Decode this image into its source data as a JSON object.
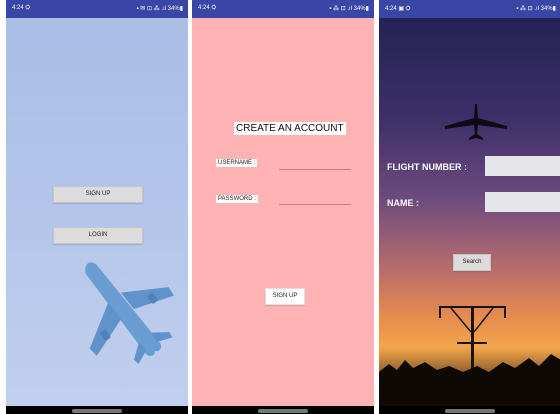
{
  "colors": {
    "statusbar": "#3a46a6",
    "login_bg": "#b3c5ea",
    "signup_bg": "#ffb3b5",
    "button_gray": "#dcdcdc"
  },
  "screens": [
    {
      "status": {
        "time": "4:24 ⛭",
        "icons": "▪ ✉ ⊡ ⁂ .ıl 34%▮"
      },
      "buttons": {
        "signup": "SIGN UP",
        "login": "LOGIN"
      },
      "illustration": "airplane-icon"
    },
    {
      "status": {
        "time": "4:24 ⛭",
        "icons": "▪ ⁂ ⊡ .ıl 34%▮"
      },
      "title": "CREATE AN ACCOUNT",
      "fields": {
        "username_label": "USERNAME :",
        "password_label": "PASSWORD :"
      },
      "button": "SIGN UP"
    },
    {
      "status": {
        "time": "4:24 ▣ ⛭",
        "icons": "▪ ⁂ ⊡ .ıl 34%▮"
      },
      "labels": {
        "flight_number": "FLIGHT NUMBER :",
        "name": "NAME :"
      },
      "button": "Search",
      "illustration": "airplane-silhouette-icon"
    }
  ]
}
